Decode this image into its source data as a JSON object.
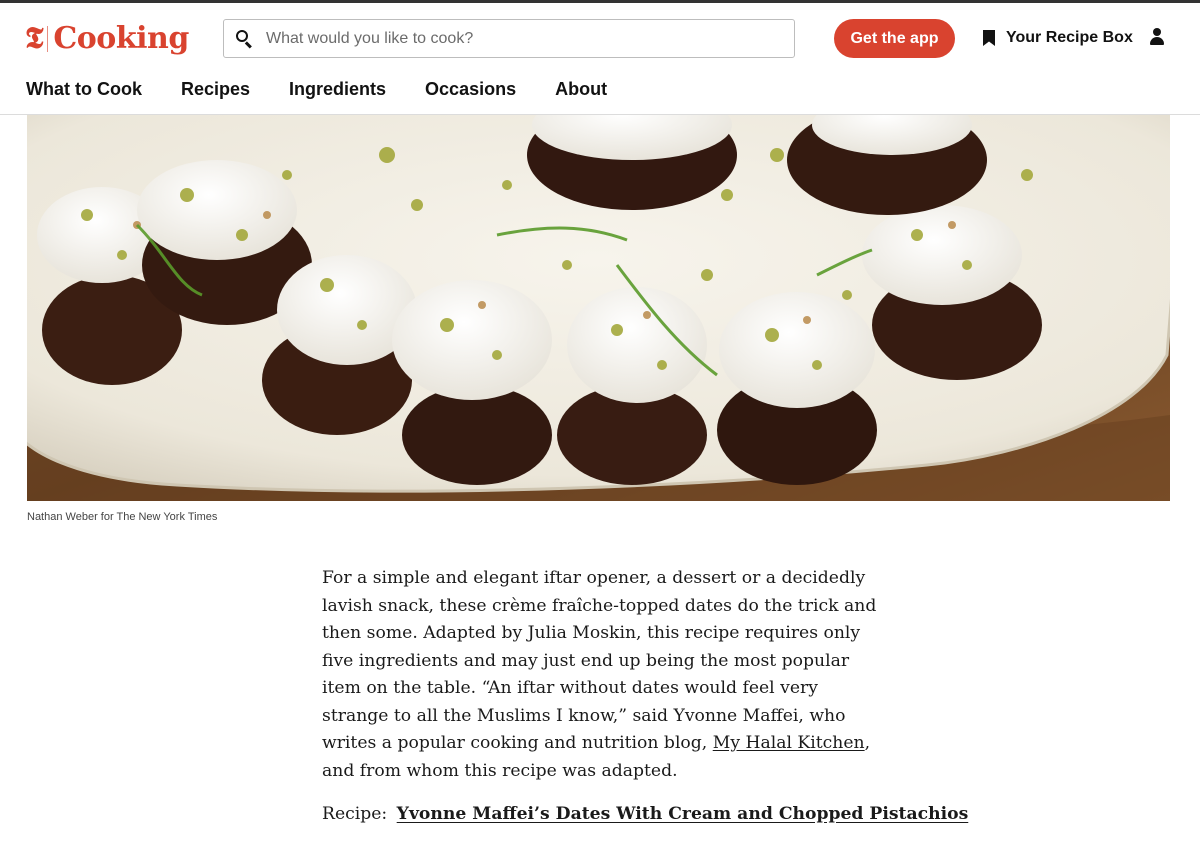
{
  "header": {
    "logo_mark": "𝕿",
    "logo_text": "Cooking",
    "search_placeholder": "What would you like to cook?",
    "get_app_label": "Get the app",
    "recipe_box_label": "Your Recipe Box"
  },
  "nav": {
    "items": [
      {
        "label": "What to Cook"
      },
      {
        "label": "Recipes"
      },
      {
        "label": "Ingredients"
      },
      {
        "label": "Occasions"
      },
      {
        "label": "About"
      }
    ]
  },
  "hero": {
    "credit": "Nathan Weber for The New York Times"
  },
  "article": {
    "intro": "For a simple and elegant iftar opener, a dessert or a decidedly lavish snack, these crème fraîche-topped dates do the trick and then some. Adapted by Julia Moskin, this recipe requires only five ingredients and may just end up being the most popular item on the table. “An iftar without dates would feel very strange to all the Muslims I know,” said Yvonne Maffei, who writes a popular cooking and nutrition blog, ",
    "blog_link": "My Halal Kitchen",
    "outro": ", and from whom this recipe was adapted.",
    "recipe_prefix": "Recipe:",
    "recipe_link": "Yvonne Maffei’s Dates With Cream and Chopped Pistachios"
  },
  "colors": {
    "brand": "#d9432f",
    "text": "#121212"
  },
  "icons": [
    "search-icon",
    "bookmark-icon",
    "user-icon"
  ]
}
